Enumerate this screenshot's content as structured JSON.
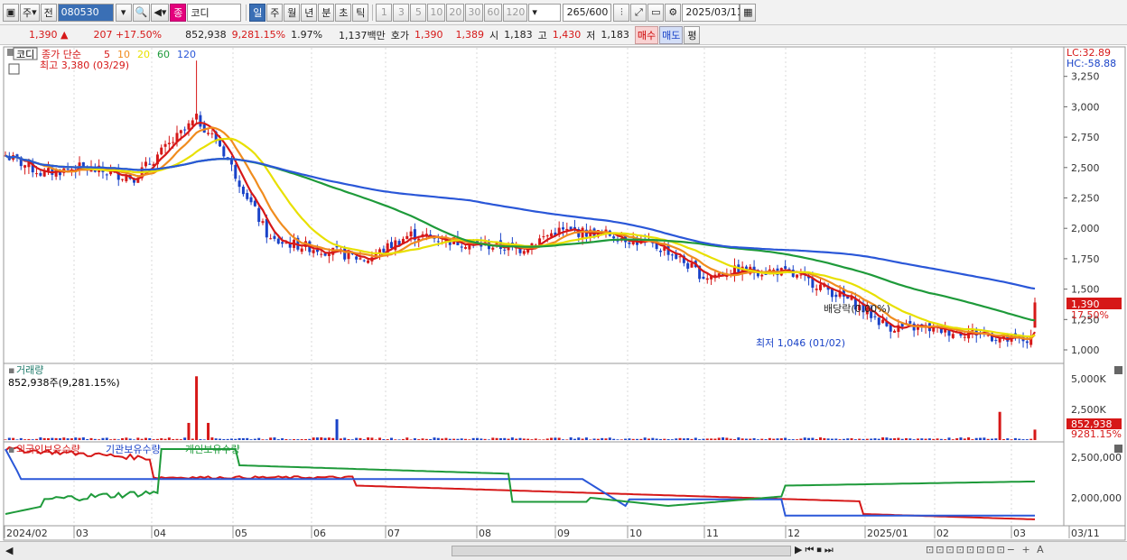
{
  "toolbar": {
    "market": "주",
    "prev": "전",
    "code": "080530",
    "name_badge": "종",
    "name": "코디",
    "periods": [
      "일",
      "주",
      "월",
      "년",
      "분",
      "초",
      "틱"
    ],
    "active_period": "일",
    "intervals": [
      "1",
      "3",
      "5",
      "10",
      "20",
      "30",
      "60",
      "120"
    ],
    "count": "265",
    "count_total": "/600",
    "date": "2025/03/11"
  },
  "quote": {
    "price": "1,390",
    "arrow": "▲",
    "change": "207",
    "change_pct": "+17.50%",
    "volume": "852,938",
    "volume_pct": "9,281.15%",
    "turnover": "1.97%",
    "amount": "1,137백만",
    "hoga_label": "호가",
    "ask": "1,390",
    "bid": "1,389",
    "open_label": "시",
    "open": "1,183",
    "high_label": "고",
    "high": "1,430",
    "low_label": "저",
    "low": "1,183",
    "buy_label": "매수",
    "sell_label": "매도",
    "eval_label": "평"
  },
  "price_panel": {
    "name": "코디",
    "legend_main": "종가 단순",
    "ma": [
      {
        "p": "5",
        "color": "#d61818"
      },
      {
        "p": "10",
        "color": "#f08c1e"
      },
      {
        "p": "20",
        "color": "#e8e000"
      },
      {
        "p": "60",
        "color": "#1e9a3a"
      },
      {
        "p": "120",
        "color": "#2a57d8"
      }
    ],
    "high_note": "최고 3,380 (03/29)",
    "low_note": "최저 1,046 (01/02)",
    "div_note": "배당락(0.00%)",
    "lc": "LC:32.89",
    "hc": "HC:-58.88",
    "price_tag": "1,390",
    "pct_tag": "17.50%",
    "y_ticks": [
      "3,250",
      "3,000",
      "2,750",
      "2,500",
      "2,250",
      "2,000",
      "1,750",
      "1,500",
      "1,250",
      "1,000"
    ]
  },
  "volume_panel": {
    "title": "거래량",
    "value": "852,938주(9,281.15%)",
    "y_ticks": [
      "5,000K",
      "2,500K"
    ],
    "tag1": "852,938",
    "tag2": "9281.15%"
  },
  "holder_panel": {
    "s1": "외국인보유수량",
    "s2": "기관보유수량",
    "s3": "개인보유수량",
    "y_ticks": [
      "2,500,000",
      "2,000,000"
    ]
  },
  "x_axis": [
    "2024/02",
    "03",
    "04",
    "05",
    "06",
    "07",
    "08",
    "09",
    "10",
    "11",
    "12",
    "2025/01",
    "02",
    "03",
    "03/11"
  ],
  "colors": {
    "up": "#d61818",
    "down": "#1a43c8"
  }
}
